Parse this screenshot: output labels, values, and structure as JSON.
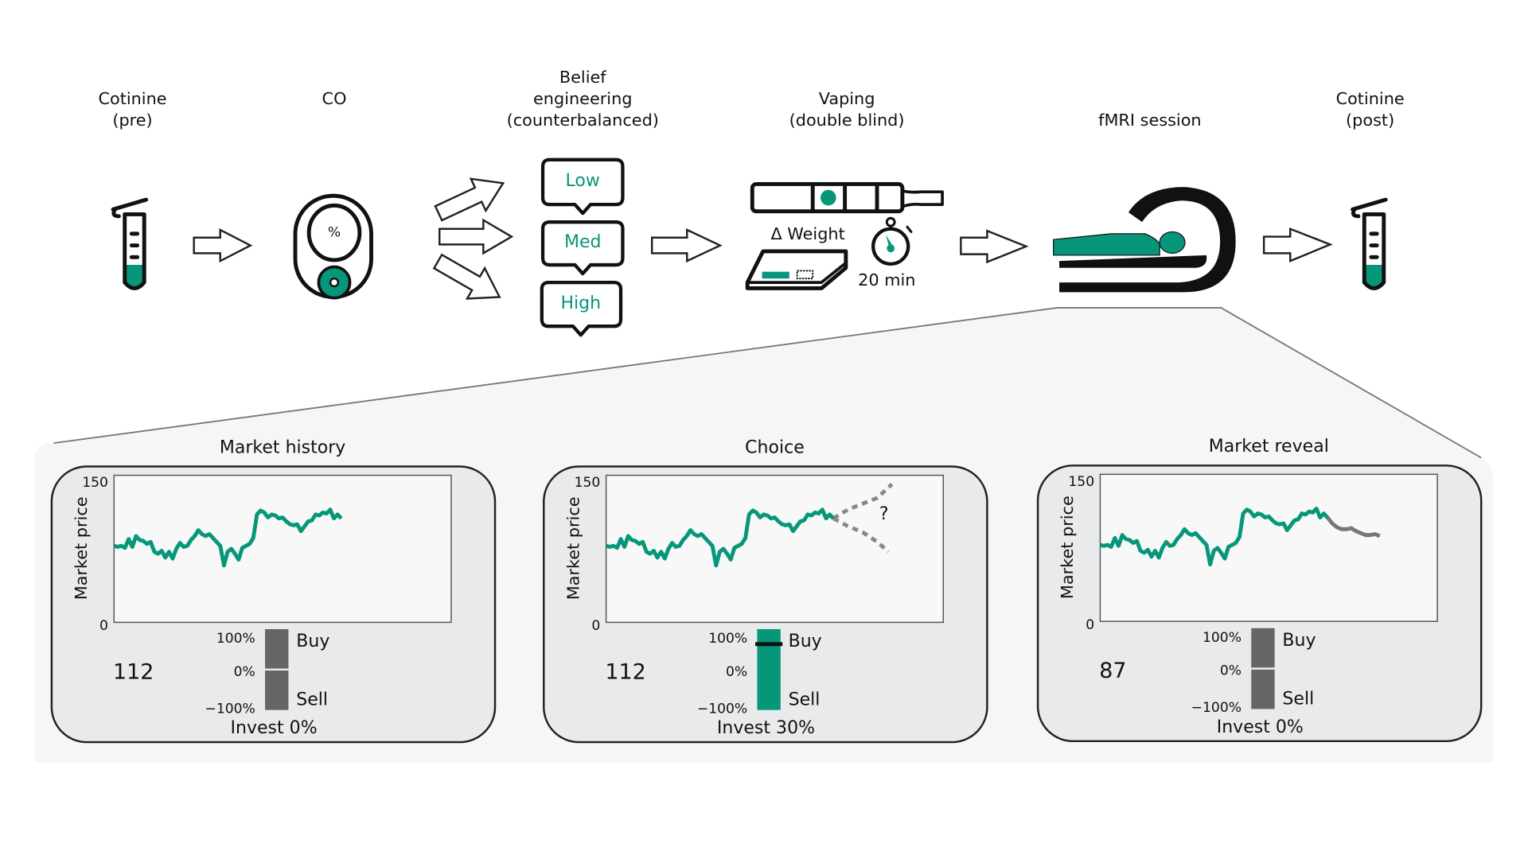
{
  "colors": {
    "accent": "#06977a",
    "ink": "#111111",
    "gray_bar": "#666666",
    "reveal_line": "#777777",
    "panel_bg": "#e9eaeb",
    "zoom_bg": "#f6f6f6"
  },
  "steps": [
    {
      "label_lines": [
        "Cotinine",
        "(pre)"
      ],
      "icon": "test-tube-icon"
    },
    {
      "label_lines": [
        "CO"
      ],
      "icon": "co-monitor-icon",
      "icon_text": "%"
    },
    {
      "label_lines": [
        "Belief",
        "engineering",
        "(counterbalanced)"
      ],
      "icon": "speech-bubbles-icon",
      "options": [
        "Low",
        "Med",
        "High"
      ]
    },
    {
      "label_lines": [
        "Vaping",
        "(double blind)"
      ],
      "icon": "vape-pen-icon",
      "weight_label": "Δ Weight",
      "timer_label": "20 min"
    },
    {
      "label_lines": [
        "fMRI session"
      ],
      "icon": "mri-scanner-icon"
    },
    {
      "label_lines": [
        "Cotinine",
        "(post)"
      ],
      "icon": "test-tube-icon"
    }
  ],
  "panels": [
    {
      "title": "Market history",
      "ylabel": "Market price",
      "ymax_label": "150",
      "ymin_label": "0",
      "price": "112",
      "buy": "Buy",
      "sell": "Sell",
      "p100": "100%",
      "p0": "0%",
      "pm100": "−100%",
      "invest": "Invest 0%",
      "invest_fraction": 0
    },
    {
      "title": "Choice",
      "ylabel": "Market price",
      "ymax_label": "150",
      "ymin_label": "0",
      "price": "112",
      "buy": "Buy",
      "sell": "Sell",
      "p100": "100%",
      "p0": "0%",
      "pm100": "−100%",
      "invest": "Invest 30%",
      "invest_fraction": 0.3,
      "unknown_mark": "?"
    },
    {
      "title": "Market reveal",
      "ylabel": "Market price",
      "ymax_label": "150",
      "ymin_label": "0",
      "price": "87",
      "buy": "Buy",
      "sell": "Sell",
      "p100": "100%",
      "p0": "0%",
      "pm100": "−100%",
      "invest": "Invest 0%",
      "invest_fraction": 0
    }
  ],
  "chart_data": {
    "type": "line",
    "ylabel": "Market price",
    "ylim": [
      0,
      150
    ],
    "xlim": [
      0,
      92
    ],
    "history": [
      78,
      77,
      78,
      76,
      85,
      77,
      88,
      84,
      83,
      80,
      82,
      72,
      70,
      73,
      66,
      72,
      65,
      75,
      81,
      77,
      78,
      84,
      88,
      94,
      90,
      88,
      90,
      86,
      82,
      78,
      58,
      72,
      75,
      70,
      64,
      76,
      78,
      80,
      86,
      110,
      114,
      112,
      107,
      110,
      109,
      106,
      107,
      103,
      100,
      99,
      100,
      93,
      98,
      103,
      104,
      110,
      109,
      112,
      111,
      115,
      106,
      110,
      106
    ],
    "choice_branches": {
      "up": [
        [
          62,
          106
        ],
        [
          66,
          115
        ],
        [
          70,
          121
        ],
        [
          74,
          127
        ],
        [
          78,
          141
        ]
      ],
      "down": [
        [
          62,
          106
        ],
        [
          66,
          98
        ],
        [
          70,
          92
        ],
        [
          74,
          82
        ],
        [
          77,
          72
        ]
      ]
    },
    "reveal": [
      106,
      100,
      96,
      94,
      94,
      95,
      92,
      90,
      88,
      88,
      89,
      87
    ]
  }
}
